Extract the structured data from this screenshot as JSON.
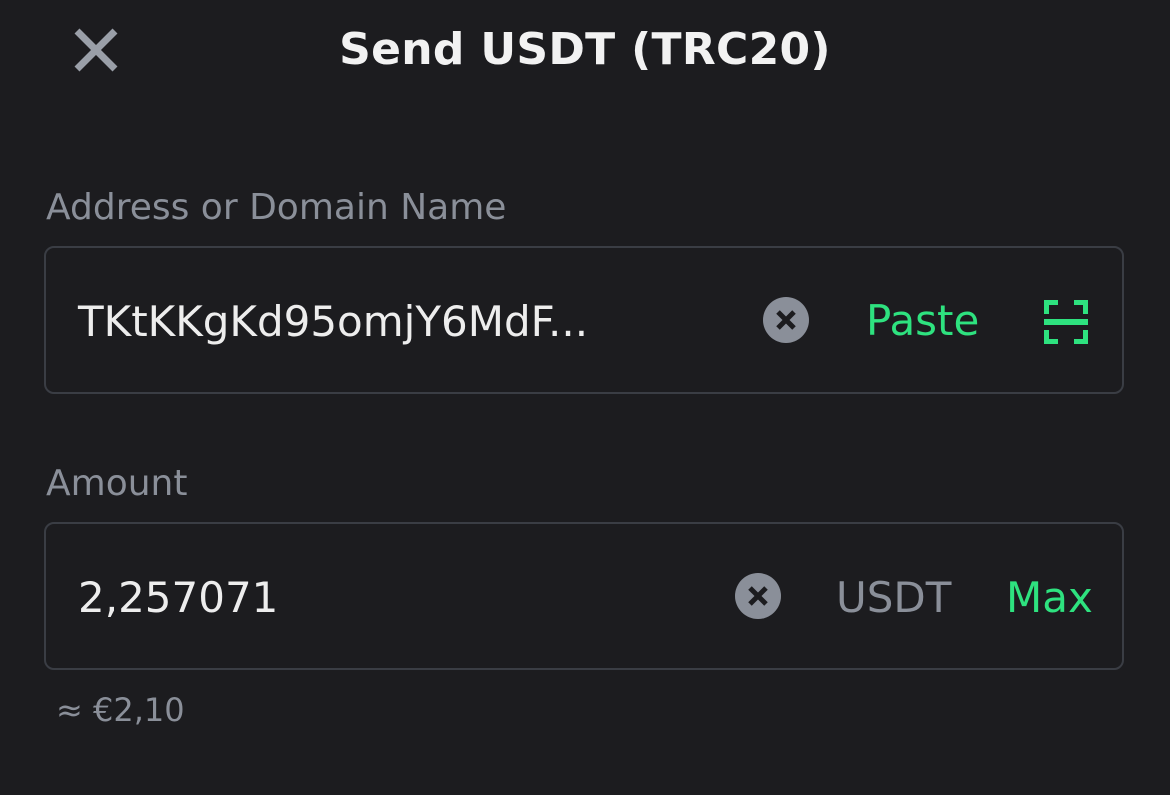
{
  "header": {
    "title": "Send USDT (TRC20)",
    "close_icon": "close-icon"
  },
  "address_field": {
    "label": "Address or Domain Name",
    "value": "TKtKKgKd95omjY6MdF...",
    "paste_label": "Paste",
    "clear_icon": "clear-circle-x-icon",
    "scan_icon": "qr-scan-icon"
  },
  "amount_field": {
    "label": "Amount",
    "value": "2,257071",
    "unit": "USDT",
    "max_label": "Max",
    "clear_icon": "clear-circle-x-icon",
    "fiat_approx": "≈ €2,10"
  },
  "colors": {
    "background": "#1c1c1f",
    "accent_green": "#2ee27f",
    "label_gray": "#8a8f99",
    "border": "#3a3d44",
    "text": "#ededed"
  }
}
